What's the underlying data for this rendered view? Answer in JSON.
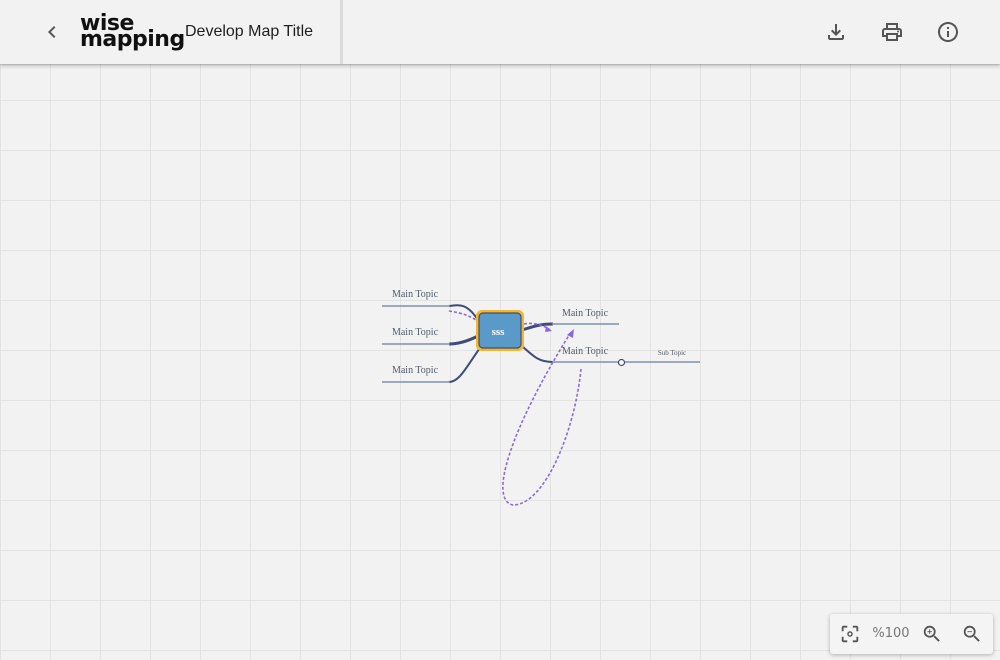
{
  "header": {
    "logo_line1": "wise",
    "logo_line2": "mapping",
    "map_title": "Develop Map Title"
  },
  "icons": {
    "back": "arrow-back-icon",
    "download": "download-icon",
    "print": "print-icon",
    "info": "info-icon",
    "fit": "center-focus-icon",
    "zoom_in": "zoom-in-icon",
    "zoom_out": "zoom-out-icon"
  },
  "mindmap": {
    "central_topic": "sss",
    "left_topics": [
      "Main Topic",
      "Main Topic",
      "Main Topic"
    ],
    "right_topics": [
      "Main Topic",
      "Main Topic"
    ],
    "sub_topic": "Sub Topic"
  },
  "zoom": {
    "level": "%100"
  },
  "colors": {
    "central_fill": "#5a9ac9",
    "central_border": "#f5b62e",
    "connector": "#3f4c7a",
    "relationship": "#8a6ad8",
    "topic_line": "#7f8fb0"
  }
}
